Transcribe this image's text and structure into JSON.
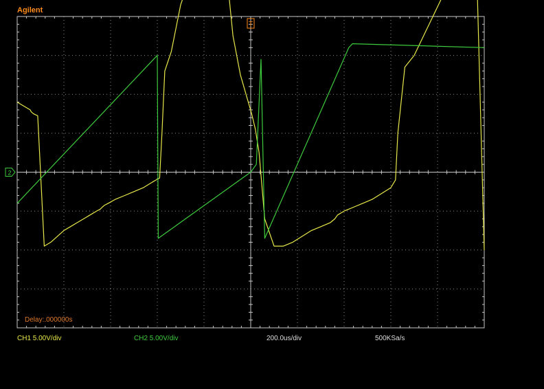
{
  "brand": "Agilent",
  "trigger_marker": "T",
  "ground_marker": "2",
  "delay_text": "Delay:.000000s",
  "status": {
    "ch1": "CH1 5.00V/div",
    "ch2": "CH2 5.00V/div",
    "timebase": "200.0us/div",
    "sample_rate": "500KSa/s"
  },
  "colors": {
    "background": "#000000",
    "grid": "#c8c8c8",
    "ch1": "#e8e84a",
    "ch2": "#3dcc3d",
    "brand": "#ff8c1a"
  },
  "chart_data": {
    "type": "line",
    "grid": "8x10 divisions",
    "series": [
      {
        "color": "#e8e84a",
        "x": [
          0,
          0.28,
          0.3,
          0.35,
          0.44,
          0.58,
          0.72,
          0.86,
          1.0,
          1.14,
          1.28,
          1.42,
          1.56,
          1.7,
          1.78,
          1.82,
          1.87,
          1.95,
          2.1,
          2.3,
          2.5,
          2.7,
          2.9,
          3.05,
          3.1,
          3.16,
          3.3,
          3.5,
          3.7,
          3.9,
          4.1,
          4.3,
          4.45,
          4.52,
          4.62,
          4.78,
          4.9,
          5.02,
          5.1,
          5.18,
          5.3,
          5.5,
          5.7,
          5.9,
          6.1,
          6.3,
          6.5,
          6.7,
          6.8,
          6.86,
          7.0,
          7.2,
          7.4,
          7.6,
          7.8,
          8.0,
          8.1,
          8.15,
          8.3,
          8.5,
          8.7,
          8.9,
          9.1,
          9.3,
          9.5,
          9.7,
          9.8,
          9.85,
          10.0
        ],
        "y": [
          5.8,
          5.6,
          5.55,
          5.5,
          5.45,
          2.1,
          2.2,
          2.35,
          2.5,
          2.6,
          2.7,
          2.8,
          2.9,
          3.0,
          3.05,
          3.1,
          3.15,
          3.2,
          3.3,
          3.4,
          3.5,
          3.6,
          3.75,
          3.85,
          5.0,
          6.6,
          7.1,
          8.3,
          9.0,
          9.3,
          9.5,
          9.7,
          9.9,
          8.7,
          7.5,
          6.5,
          6.0,
          5.5,
          5.1,
          4.5,
          2.8,
          2.1,
          2.1,
          2.2,
          2.35,
          2.5,
          2.6,
          2.7,
          2.8,
          2.9,
          3.0,
          3.1,
          3.2,
          3.3,
          3.45,
          3.6,
          3.8,
          5.0,
          6.7,
          7.0,
          7.5,
          8.0,
          8.5,
          9.0,
          9.3,
          9.7,
          9.9,
          8.7,
          2.0
        ],
        "note_unused": ""
      },
      {
        "color": "#3dcc3d",
        "x": [
          0,
          3.0,
          3.02,
          5.0,
          5.12,
          5.22,
          5.3,
          7.1,
          7.18,
          10.0
        ],
        "y": [
          3.2,
          7.0,
          2.3,
          4.0,
          4.2,
          6.9,
          2.3,
          7.2,
          7.3,
          7.2
        ]
      }
    ],
    "xlim": [
      0,
      10
    ],
    "ylim": [
      0,
      8
    ]
  }
}
